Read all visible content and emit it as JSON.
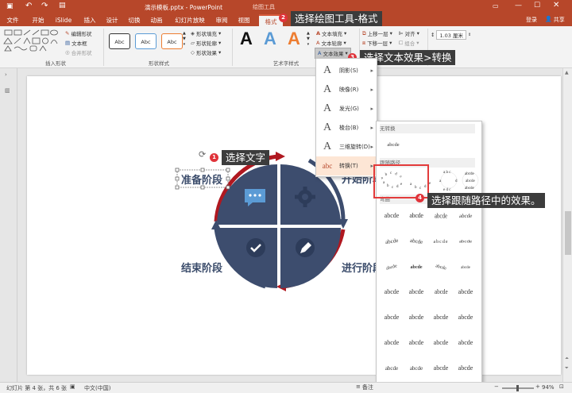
{
  "titlebar": {
    "doc_title": "演示模板.pptx - PowerPoint",
    "context_tool": "绘图工具",
    "login": "登录",
    "share": "共享"
  },
  "tabs": [
    "文件",
    "开始",
    "iSlide",
    "插入",
    "设计",
    "切换",
    "动画",
    "幻灯片放映",
    "审阅",
    "视图",
    "格式"
  ],
  "ribbon": {
    "insert_shapes": {
      "label": "插入形状",
      "edit_shape": "编辑形状",
      "text_box": "文本框",
      "merge_shapes": "合并形状"
    },
    "shape_styles": {
      "label": "形状样式",
      "thumb": "Abc",
      "fill": "形状填充",
      "outline": "形状轮廓",
      "effects": "形状效果"
    },
    "wordart": {
      "label": "艺术字样式",
      "glyph": "A",
      "text_fill": "文本填充",
      "text_outline": "文本轮廓",
      "text_effects": "文本效果"
    },
    "arrange": {
      "bring_forward": "上移一层",
      "send_backward": "下移一层",
      "align": "对齐",
      "group": "组合",
      "rotate": "旋转"
    },
    "size": {
      "height": "1.03 厘米"
    }
  },
  "text_effects_menu": {
    "items": [
      {
        "label": "阴影(S)",
        "glyph": "A"
      },
      {
        "label": "映像(R)",
        "glyph": "A"
      },
      {
        "label": "发光(G)",
        "glyph": "A"
      },
      {
        "label": "棱台(B)",
        "glyph": "A"
      },
      {
        "label": "三维旋转(D)",
        "glyph": "A"
      },
      {
        "label": "转换(T)",
        "glyph": "abc"
      }
    ]
  },
  "transform_gallery": {
    "no_transform_header": "无转换",
    "no_transform_sample": "abcde",
    "follow_path_header": "跟随路径",
    "warp_header": "弯曲",
    "sample": "abcde"
  },
  "callouts": {
    "c1": "选择文字",
    "c2": "选择绘图工具-格式",
    "c3": "选择文本效果>转换",
    "c4": "选择跟随路径中的效果。"
  },
  "badges": {
    "b1": "1",
    "b2": "2",
    "b3": "3",
    "b4": "4"
  },
  "slide": {
    "stage1": "准备阶段",
    "stage2": "开始阶段",
    "stage3": "进行阶段",
    "stage4": "结束阶段",
    "rotate_glyph": "⟳"
  },
  "statusbar": {
    "slide_info": "幻灯片 第 4 张，共 6 张",
    "language": "中文(中国)",
    "notes": "备注",
    "zoom": "94%"
  },
  "colors": {
    "accent": "#b7472a",
    "callout": "#3c3c3c",
    "badge": "#e0333a",
    "slide_text": "#3b4c6b",
    "diagram_fill": "#3d4d6e",
    "highlight": "#e33b3b"
  }
}
